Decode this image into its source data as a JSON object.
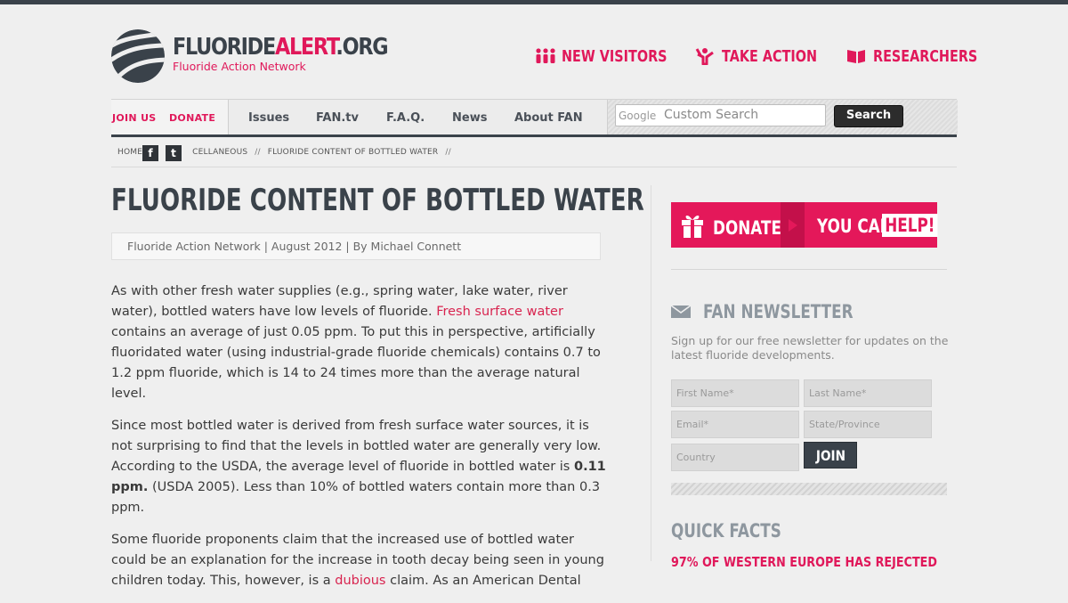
{
  "logo": {
    "name_part1": "FLUORIDE",
    "name_part2": "ALERT",
    "name_part3": ".ORG",
    "subtitle": "Fluoride Action Network"
  },
  "top_nav": [
    {
      "label": "NEW VISITORS",
      "icon": "people-icon"
    },
    {
      "label": "TAKE ACTION",
      "icon": "megaphone-icon"
    },
    {
      "label": "RESEARCHERS",
      "icon": "book-icon"
    }
  ],
  "nav": {
    "join": "JOIN US",
    "donate": "DONATE",
    "items": [
      "Issues",
      "FAN.tv",
      "F.A.Q.",
      "News",
      "About FAN"
    ],
    "search_brand": "Google",
    "search_placeholder": "Custom Search",
    "search_button": "Search"
  },
  "breadcrumb": {
    "home": "HOME",
    "cat": "CELLANEOUS",
    "current": "FLUORIDE CONTENT OF BOTTLED WATER",
    "sep": "//"
  },
  "social": {
    "facebook": "f",
    "twitter": "t"
  },
  "article": {
    "title": "FLUORIDE CONTENT OF BOTTLED WATER",
    "meta": "Fluoride Action Network | August 2012 | By Michael Connett",
    "p1_a": "As with other fresh water supplies (e.g., spring water, lake water, river water), bottled waters have low levels of fluoride. ",
    "p1_link": "Fresh surface water",
    "p1_b": " contains an average of just 0.05 ppm. To put this in perspective, artificially fluoridated water (using industrial-grade fluoride chemicals) contains 0.7 to 1.2 ppm fluoride, which is 14 to 24 times more than the average natural level.",
    "p2_a": "Since most bottled water is derived from fresh surface water sources, it is not surprising to find that the levels in bottled water are generally very low. According to the USDA, the average level of fluoride in bottled water is ",
    "p2_bold": "0.11 ppm.",
    "p2_b": " (USDA 2005). Less than 10% of bottled waters contain more than 0.3 ppm.",
    "p3_a": "Some fluoride proponents claim that the increased use of bottled water could be an explanation for the increase in tooth decay being seen in young children today. This, however, is a ",
    "p3_link": "dubious",
    "p3_b": " claim. As an American Dental"
  },
  "sidebar": {
    "donate": "DONATE",
    "you_can": "YOU CAN",
    "help": "HELP!",
    "newsletter_title": "FAN NEWSLETTER",
    "newsletter_desc": "Sign up for our free newsletter for updates on the latest fluoride developments.",
    "first_name": "First Name*",
    "last_name": "Last Name*",
    "email": "Email*",
    "state": "State/Province",
    "country": "Country",
    "join": "JOIN",
    "quick_facts": "QUICK FACTS",
    "quick_fact_1": "97% OF WESTERN EUROPE HAS REJECTED"
  },
  "colors": {
    "accent": "#e0185a",
    "dark": "#3a424a",
    "muted": "#8e979f"
  }
}
